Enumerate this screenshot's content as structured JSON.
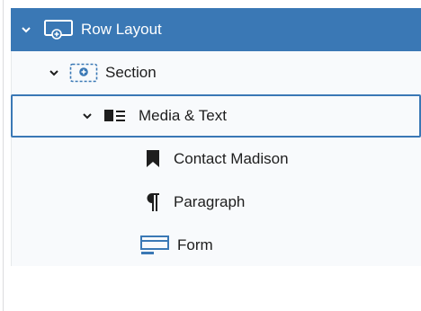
{
  "list_view": {
    "items": [
      {
        "label": "Row Layout",
        "icon": "row-layout-icon",
        "expanded": true,
        "selected": true,
        "level": 1
      },
      {
        "label": "Section",
        "icon": "section-icon",
        "expanded": true,
        "level": 2
      },
      {
        "label": "Media & Text",
        "icon": "media-text-icon",
        "expanded": true,
        "highlighted": true,
        "level": 3
      },
      {
        "label": "Contact Madison",
        "icon": "bookmark-icon",
        "level": 4
      },
      {
        "label": "Paragraph",
        "icon": "paragraph-icon",
        "level": 4
      },
      {
        "label": "Form",
        "icon": "form-icon",
        "level": 4
      }
    ]
  },
  "colors": {
    "accent": "#3a78b5",
    "panel_bg": "#f8fafc",
    "text": "#1e1e1e"
  }
}
